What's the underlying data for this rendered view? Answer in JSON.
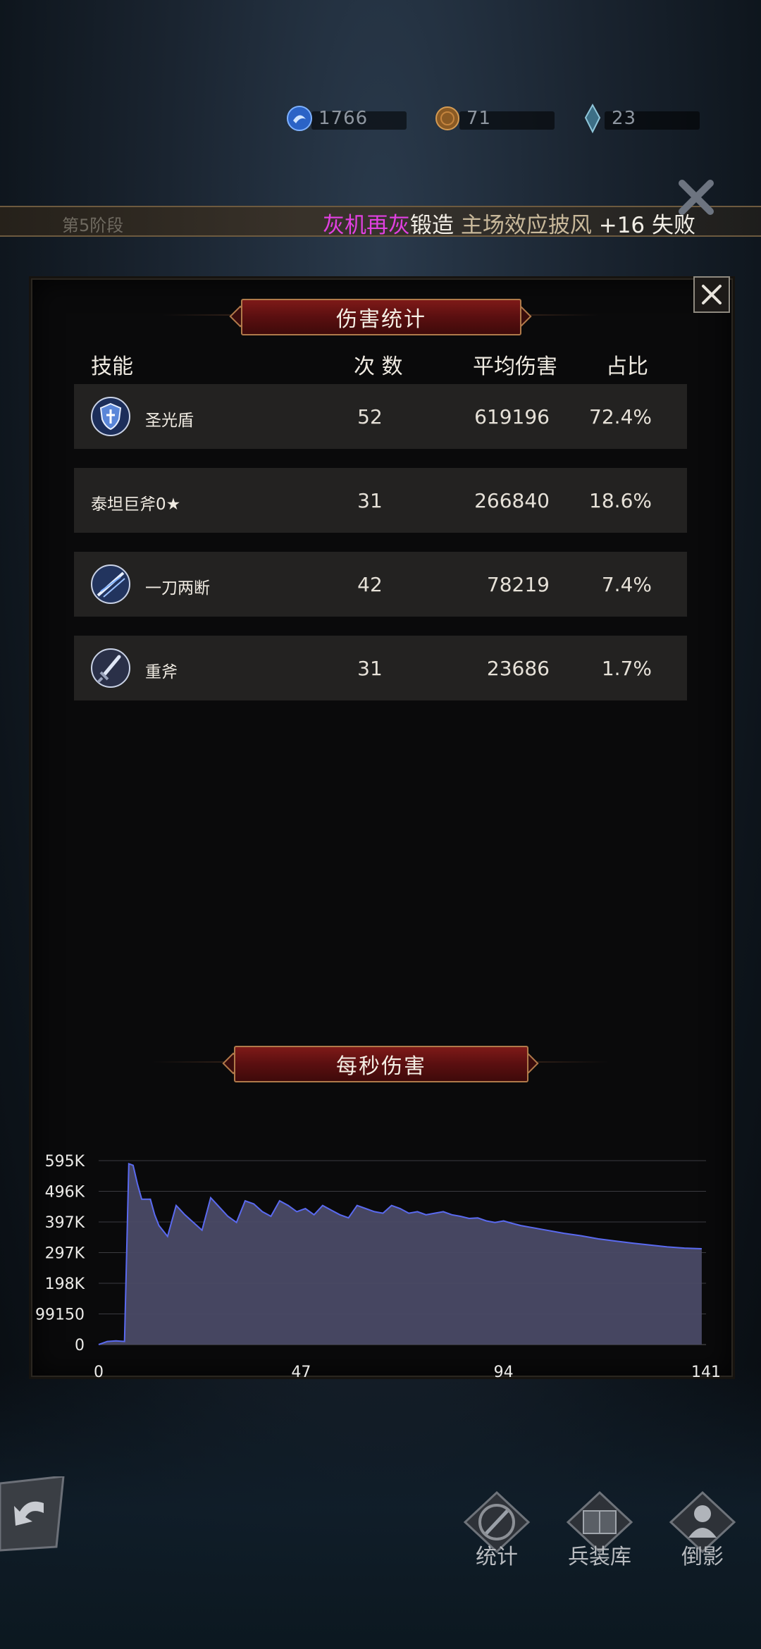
{
  "currency": [
    {
      "icon": "blue-orb-icon",
      "value": "1766"
    },
    {
      "icon": "bronze-coin-icon",
      "value": "71"
    },
    {
      "icon": "crystal-shard-icon",
      "value": "23"
    }
  ],
  "stage": {
    "label": "第5阶段",
    "ticker": {
      "part1": "灰机再灰",
      "part2": "锻造",
      "part3": "主场效应披风",
      "part4": "+16",
      "part5": "失败"
    }
  },
  "colors": {
    "accent_red": "#7e1a18",
    "chart_fill": "#4a4a66",
    "chart_line": "#5a6af0",
    "magenta": "#e040e0"
  },
  "damage_stats": {
    "title": "伤害统计",
    "headers": {
      "skill": "技能",
      "count": "次 数",
      "avg": "平均伤害",
      "share": "占比"
    },
    "rows": [
      {
        "icon": "shield-skill-icon",
        "name": "圣光盾",
        "count": "52",
        "avg": "619196",
        "share": "72.4%"
      },
      {
        "icon": "",
        "name": "泰坦巨斧0★",
        "count": "31",
        "avg": "266840",
        "share": "18.6%"
      },
      {
        "icon": "slash-skill-icon",
        "name": "一刀两断",
        "count": "42",
        "avg": "78219",
        "share": "7.4%"
      },
      {
        "icon": "sword-skill-icon",
        "name": "重斧",
        "count": "31",
        "avg": "23686",
        "share": "1.7%"
      }
    ]
  },
  "dps": {
    "title": "每秒伤害"
  },
  "chart_data": {
    "type": "area",
    "title": "每秒伤害",
    "xlabel": "",
    "ylabel": "",
    "xlim": [
      0,
      141
    ],
    "ylim": [
      0,
      595000
    ],
    "x_ticks": [
      "0",
      "47",
      "94",
      "141"
    ],
    "y_ticks": [
      "0",
      "99150",
      "198K",
      "297K",
      "397K",
      "496K",
      "595K"
    ],
    "grid": true,
    "series": [
      {
        "x": [
          0,
          2,
          4,
          6,
          7,
          8,
          9,
          10,
          12,
          13,
          14,
          16,
          18,
          20,
          22,
          24,
          26,
          28,
          30,
          32,
          34,
          36,
          38,
          40,
          42,
          44,
          46,
          48,
          50,
          52,
          54,
          56,
          58,
          60,
          62,
          64,
          66,
          68,
          70,
          72,
          74,
          76,
          78,
          80,
          82,
          84,
          86,
          88,
          90,
          92,
          94,
          96,
          98,
          100,
          104,
          108,
          112,
          116,
          120,
          124,
          128,
          132,
          136,
          140
        ],
        "y": [
          0,
          10000,
          12000,
          10000,
          585000,
          580000,
          520000,
          470000,
          470000,
          420000,
          385000,
          350000,
          450000,
          420000,
          395000,
          370000,
          475000,
          445000,
          415000,
          395000,
          465000,
          455000,
          430000,
          415000,
          465000,
          450000,
          430000,
          440000,
          420000,
          450000,
          435000,
          420000,
          410000,
          450000,
          440000,
          430000,
          425000,
          450000,
          440000,
          425000,
          430000,
          420000,
          425000,
          430000,
          420000,
          415000,
          408000,
          410000,
          400000,
          395000,
          400000,
          392000,
          385000,
          380000,
          370000,
          360000,
          352000,
          342000,
          335000,
          328000,
          322000,
          316000,
          312000,
          310000
        ]
      }
    ]
  },
  "nav": {
    "stats": "统计",
    "armory": "兵装库",
    "shadow": "倒影"
  }
}
